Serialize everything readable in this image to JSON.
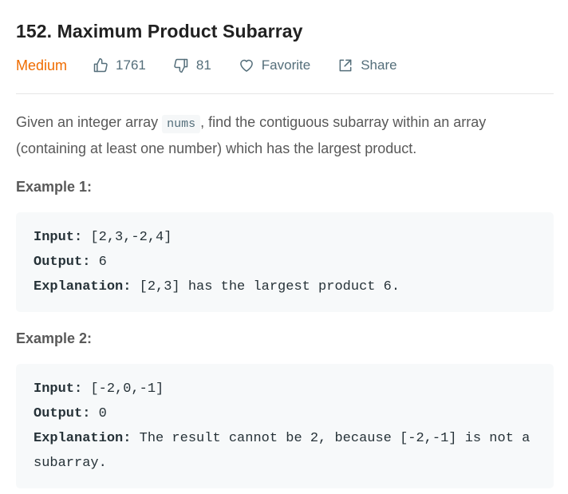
{
  "problem": {
    "title": "152. Maximum Product Subarray",
    "difficulty": "Medium",
    "likes": "1761",
    "dislikes": "81",
    "favorite_label": "Favorite",
    "share_label": "Share",
    "description_part1": "Given an integer array ",
    "description_code": "nums",
    "description_part2": ", find the contiguous subarray within an array (containing at least one number) which has the largest product."
  },
  "examples": [
    {
      "title": "Example 1:",
      "input_label": "Input:",
      "input_value": " [2,3,-2,4]",
      "output_label": "Output:",
      "output_value": " 6",
      "explanation_label": "Explanation:",
      "explanation_value": " [2,3] has the largest product 6."
    },
    {
      "title": "Example 2:",
      "input_label": "Input:",
      "input_value": " [-2,0,-1]",
      "output_label": "Output:",
      "output_value": " 0",
      "explanation_label": "Explanation:",
      "explanation_value": " The result cannot be 2, because [-2,-1] is not a subarray."
    }
  ],
  "colors": {
    "difficulty_medium": "#ef6c00",
    "meta_text": "#546e7a"
  }
}
